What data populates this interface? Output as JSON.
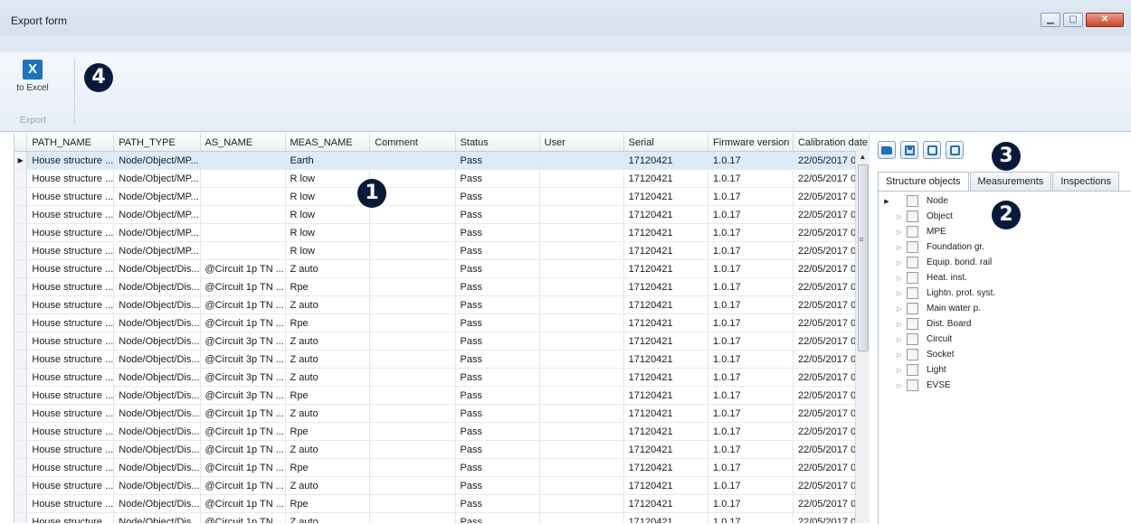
{
  "window": {
    "title": "Export form"
  },
  "ribbon": {
    "excel_icon_letter": "X",
    "excel_label": "to Excel",
    "group_label": "Export",
    "excel_icon": "excel-icon"
  },
  "badges": {
    "one": "1",
    "two": "2",
    "three": "3",
    "four": "4"
  },
  "grid": {
    "columns": [
      "PATH_NAME",
      "PATH_TYPE",
      "AS_NAME",
      "MEAS_NAME",
      "Comment",
      "Status",
      "User",
      "Serial",
      "Firmware version",
      "Calibration date"
    ],
    "rows": [
      [
        "House structure ...",
        "Node/Object/MP...",
        "",
        "Earth",
        "",
        "Pass",
        "",
        "17120421",
        "1.0.17",
        "22/05/2017 0"
      ],
      [
        "House structure ...",
        "Node/Object/MP...",
        "",
        "R low",
        "",
        "Pass",
        "",
        "17120421",
        "1.0.17",
        "22/05/2017 0"
      ],
      [
        "House structure ...",
        "Node/Object/MP...",
        "",
        "R low",
        "",
        "Pass",
        "",
        "17120421",
        "1.0.17",
        "22/05/2017 0"
      ],
      [
        "House structure ...",
        "Node/Object/MP...",
        "",
        "R low",
        "",
        "Pass",
        "",
        "17120421",
        "1.0.17",
        "22/05/2017 0"
      ],
      [
        "House structure ...",
        "Node/Object/MP...",
        "",
        "R low",
        "",
        "Pass",
        "",
        "17120421",
        "1.0.17",
        "22/05/2017 0"
      ],
      [
        "House structure ...",
        "Node/Object/MP...",
        "",
        "R low",
        "",
        "Pass",
        "",
        "17120421",
        "1.0.17",
        "22/05/2017 0"
      ],
      [
        "House structure ...",
        "Node/Object/Dis...",
        "@Circuit 1p TN ...",
        "Z auto",
        "",
        "Pass",
        "",
        "17120421",
        "1.0.17",
        "22/05/2017 0"
      ],
      [
        "House structure ...",
        "Node/Object/Dis...",
        "@Circuit 1p TN ...",
        "Rpe",
        "",
        "Pass",
        "",
        "17120421",
        "1.0.17",
        "22/05/2017 0"
      ],
      [
        "House structure ...",
        "Node/Object/Dis...",
        "@Circuit 1p TN ...",
        "Z auto",
        "",
        "Pass",
        "",
        "17120421",
        "1.0.17",
        "22/05/2017 0"
      ],
      [
        "House structure ...",
        "Node/Object/Dis...",
        "@Circuit 1p TN ...",
        "Rpe",
        "",
        "Pass",
        "",
        "17120421",
        "1.0.17",
        "22/05/2017 0"
      ],
      [
        "House structure ...",
        "Node/Object/Dis...",
        "@Circuit 3p TN ...",
        "Z auto",
        "",
        "Pass",
        "",
        "17120421",
        "1.0.17",
        "22/05/2017 0"
      ],
      [
        "House structure ...",
        "Node/Object/Dis...",
        "@Circuit 3p TN ...",
        "Z auto",
        "",
        "Pass",
        "",
        "17120421",
        "1.0.17",
        "22/05/2017 0"
      ],
      [
        "House structure ...",
        "Node/Object/Dis...",
        "@Circuit 3p TN ...",
        "Z auto",
        "",
        "Pass",
        "",
        "17120421",
        "1.0.17",
        "22/05/2017 0"
      ],
      [
        "House structure ...",
        "Node/Object/Dis...",
        "@Circuit 3p TN ...",
        "Rpe",
        "",
        "Pass",
        "",
        "17120421",
        "1.0.17",
        "22/05/2017 0"
      ],
      [
        "House structure ...",
        "Node/Object/Dis...",
        "@Circuit 1p TN ...",
        "Z auto",
        "",
        "Pass",
        "",
        "17120421",
        "1.0.17",
        "22/05/2017 0"
      ],
      [
        "House structure ...",
        "Node/Object/Dis...",
        "@Circuit 1p TN ...",
        "Rpe",
        "",
        "Pass",
        "",
        "17120421",
        "1.0.17",
        "22/05/2017 0"
      ],
      [
        "House structure ...",
        "Node/Object/Dis...",
        "@Circuit 1p TN ...",
        "Z auto",
        "",
        "Pass",
        "",
        "17120421",
        "1.0.17",
        "22/05/2017 0"
      ],
      [
        "House structure ...",
        "Node/Object/Dis...",
        "@Circuit 1p TN ...",
        "Rpe",
        "",
        "Pass",
        "",
        "17120421",
        "1.0.17",
        "22/05/2017 0"
      ],
      [
        "House structure ...",
        "Node/Object/Dis...",
        "@Circuit 1p TN ...",
        "Z auto",
        "",
        "Pass",
        "",
        "17120421",
        "1.0.17",
        "22/05/2017 0"
      ],
      [
        "House structure ...",
        "Node/Object/Dis...",
        "@Circuit 1p TN ...",
        "Rpe",
        "",
        "Pass",
        "",
        "17120421",
        "1.0.17",
        "22/05/2017 0"
      ],
      [
        "House structure ...",
        "Node/Object/Dis...",
        "@Circuit 1p TN ...",
        "Z auto",
        "",
        "Pass",
        "",
        "17120421",
        "1.0.17",
        "22/05/2017 0"
      ]
    ],
    "selected_row": 0
  },
  "right_panel": {
    "toolbar_icons": [
      "open-folder-icon",
      "save-icon",
      "check-all-icon",
      "uncheck-all-icon"
    ],
    "tabs": [
      "Structure objects",
      "Measurements",
      "Inspections"
    ],
    "active_tab": 0,
    "tree": [
      "Node",
      "Object",
      "MPE",
      "Foundation gr.",
      "Equip. bond. rail",
      "Heat. inst.",
      "Lightn. prot. syst.",
      "Main water p.",
      "Dist. Board",
      "Circuit",
      "Socket",
      "Light",
      "EVSE"
    ]
  }
}
